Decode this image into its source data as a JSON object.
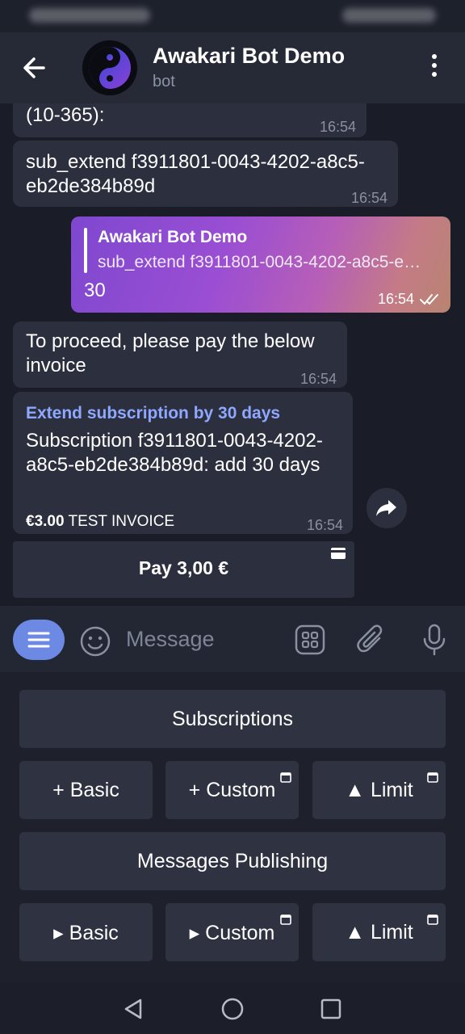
{
  "header": {
    "title": "Awakari Bot Demo",
    "subtitle": "bot"
  },
  "messages": {
    "m1": {
      "text": "(10-365):",
      "time": "16:54"
    },
    "m2": {
      "text": "sub_extend f3911801-0043-4202-a8c5-eb2de384b89d",
      "time": "16:54"
    },
    "m3": {
      "reply_name": "Awakari Bot Demo",
      "reply_text": "sub_extend f3911801-0043-4202-a8c5-e…",
      "text": "30",
      "time": "16:54"
    },
    "m4": {
      "text": "To proceed, please pay the below invoice",
      "time": "16:54"
    },
    "invoice": {
      "title": "Extend subscription by 30 days",
      "description": "Subscription f3911801-0043-4202-a8c5-eb2de384b89d: add 30 days",
      "amount": "€3.00",
      "tag": "TEST INVOICE",
      "time": "16:54",
      "pay_label": "Pay 3,00 €"
    }
  },
  "input": {
    "placeholder": "Message"
  },
  "bot_keyboard": {
    "row1": "Subscriptions",
    "row2": [
      "+ Basic",
      "+ Custom",
      "▲ Limit"
    ],
    "row3": "Messages Publishing",
    "row4": [
      "▸ Basic",
      "▸ Custom",
      "▲ Limit"
    ]
  },
  "colors": {
    "background": "#1a1d27",
    "bubble_in": "#2c2f3e",
    "accent": "#6c8ae4",
    "invoice_title": "#8fa8ff"
  }
}
